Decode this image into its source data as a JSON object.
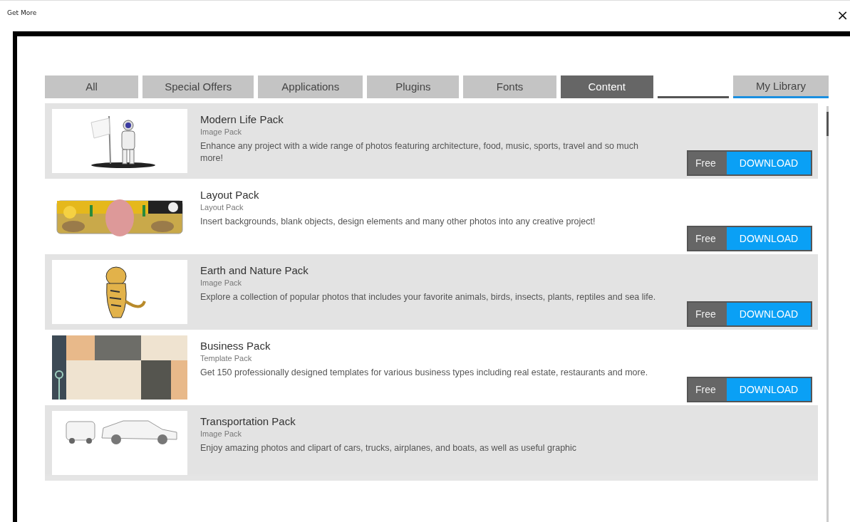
{
  "window": {
    "title": "Get More",
    "close": "×"
  },
  "tabs": [
    {
      "label": "All",
      "selected": false
    },
    {
      "label": "Special Offers",
      "selected": false
    },
    {
      "label": "Applications",
      "selected": false
    },
    {
      "label": "Plugins",
      "selected": false
    },
    {
      "label": "Fonts",
      "selected": false
    },
    {
      "label": "Content",
      "selected": true
    }
  ],
  "library_tab": {
    "label": "My Library",
    "selected": false
  },
  "items": [
    {
      "title": "Modern Life Pack",
      "type": "Image Pack",
      "description": "Enhance any project with a wide range of photos featuring architecture, food, music, sports, travel and so much more!",
      "price": "Free",
      "action": "DOWNLOAD"
    },
    {
      "title": "Layout Pack",
      "type": "Layout Pack",
      "description": "Insert backgrounds, blank objects, design elements and many other photos into any creative project!",
      "price": "Free",
      "action": "DOWNLOAD"
    },
    {
      "title": "Earth and Nature Pack",
      "type": "Image Pack",
      "description": "Explore a collection of popular photos that includes your favorite animals, birds, insects, plants, reptiles and sea life.",
      "price": "Free",
      "action": "DOWNLOAD"
    },
    {
      "title": "Business Pack",
      "type": "Template Pack",
      "description": "Get 150 professionally designed templates for various business types including real estate, restaurants and more.",
      "price": "Free",
      "action": "DOWNLOAD"
    },
    {
      "title": "Transportation Pack",
      "type": "Image Pack",
      "description": "Enjoy amazing photos and clipart of cars, trucks, airplanes, and boats, as well as useful graphic"
    }
  ]
}
